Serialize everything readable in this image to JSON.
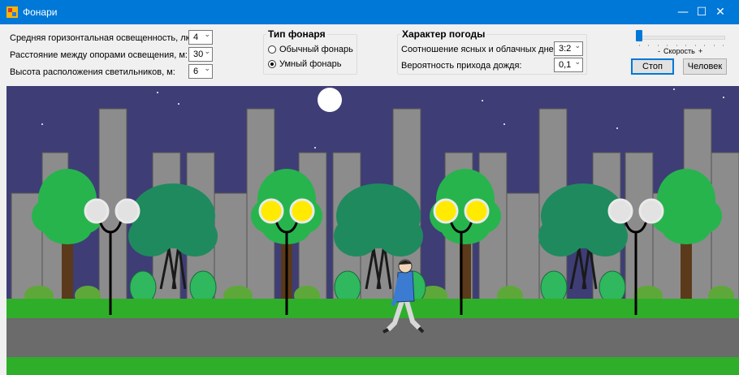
{
  "window": {
    "title": "Фонари",
    "min_glyph": "—",
    "max_glyph": "☐",
    "close_glyph": "✕",
    "titlebar_color": "#0078d7"
  },
  "params": {
    "illuminance_label": "Средняя горизонтальная освещенность, лк:",
    "illuminance_value": "4",
    "distance_label": "Расстояние между опорами освещения, м:",
    "distance_value": "30",
    "height_label": "Высота расположения светильников, м:",
    "height_value": "6"
  },
  "lamp_type": {
    "title": "Тип фонаря",
    "options": [
      {
        "label": "Обычный фонарь",
        "selected": false
      },
      {
        "label": "Умный фонарь",
        "selected": true
      }
    ]
  },
  "weather": {
    "title": "Характер погоды",
    "ratio_label": "Соотношение ясных и облачных дней:",
    "ratio_value": "3:2",
    "rain_label": "Вероятность прихода дождя:",
    "rain_value": "0,1"
  },
  "speed": {
    "minus": "-",
    "label": "Скорость",
    "plus": "+",
    "level": 0
  },
  "buttons": {
    "stop": "Стоп",
    "human": "Человек"
  },
  "scene": {
    "sky_color": "#3e3d76",
    "building_color": "#8c8c8c",
    "grass_color": "#2fae2a",
    "road_color": "#6b6b6b",
    "lamp_on_color": "#ffea00",
    "lamp_off_color": "#e2e2e2",
    "lamps": [
      {
        "lit": false
      },
      {
        "lit": true
      },
      {
        "lit": true
      },
      {
        "lit": false
      }
    ]
  }
}
